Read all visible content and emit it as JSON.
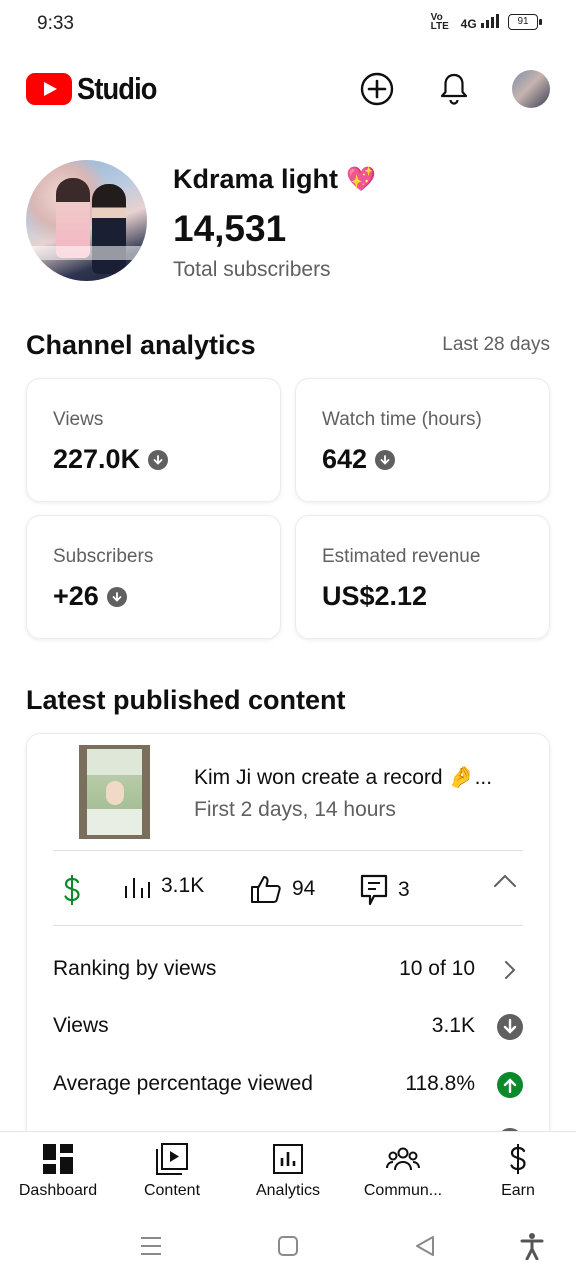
{
  "status_bar": {
    "time": "9:33",
    "network_volte": "Vo\nLTE",
    "network": "4G",
    "battery": "91"
  },
  "app": {
    "logo_text": "Studio"
  },
  "channel": {
    "name": "Kdrama light",
    "emoji": "💖",
    "subscriber_count": "14,531",
    "subscriber_label": "Total subscribers",
    "avatar_caption": ""
  },
  "analytics": {
    "title": "Channel analytics",
    "period": "Last 28 days",
    "cards": [
      {
        "label": "Views",
        "value": "227.0K",
        "trend": "down"
      },
      {
        "label": "Watch time (hours)",
        "value": "642",
        "trend": "down"
      },
      {
        "label": "Subscribers",
        "value": "+26",
        "trend": "down"
      },
      {
        "label": "Estimated revenue",
        "value": "US$2.12",
        "trend": "none"
      }
    ]
  },
  "latest": {
    "title": "Latest published content",
    "video_title": "Kim Ji won create a record 🤌...",
    "video_subtitle": "First 2 days, 14 hours",
    "stats": {
      "views": "3.1K",
      "likes": "94",
      "comments": "3"
    },
    "rows": [
      {
        "label": "Ranking by views",
        "value": "10 of 10",
        "icon": "chevron-right-icon"
      },
      {
        "label": "Views",
        "value": "3.1K",
        "icon": "down-arrow-icon"
      },
      {
        "label": "Average percentage viewed",
        "value": "118.8%",
        "icon": "up-arrow-icon"
      }
    ]
  },
  "bottom_nav": [
    {
      "label": "Dashboard"
    },
    {
      "label": "Content"
    },
    {
      "label": "Analytics"
    },
    {
      "label": "Commun..."
    },
    {
      "label": "Earn"
    }
  ],
  "colors": {
    "brand_red": "#ff0000",
    "text_primary": "#0f0f0f",
    "text_secondary": "#606060",
    "trend_down": "#606060",
    "trend_up": "#0b8a2b",
    "money_green": "#0b8a2b"
  }
}
